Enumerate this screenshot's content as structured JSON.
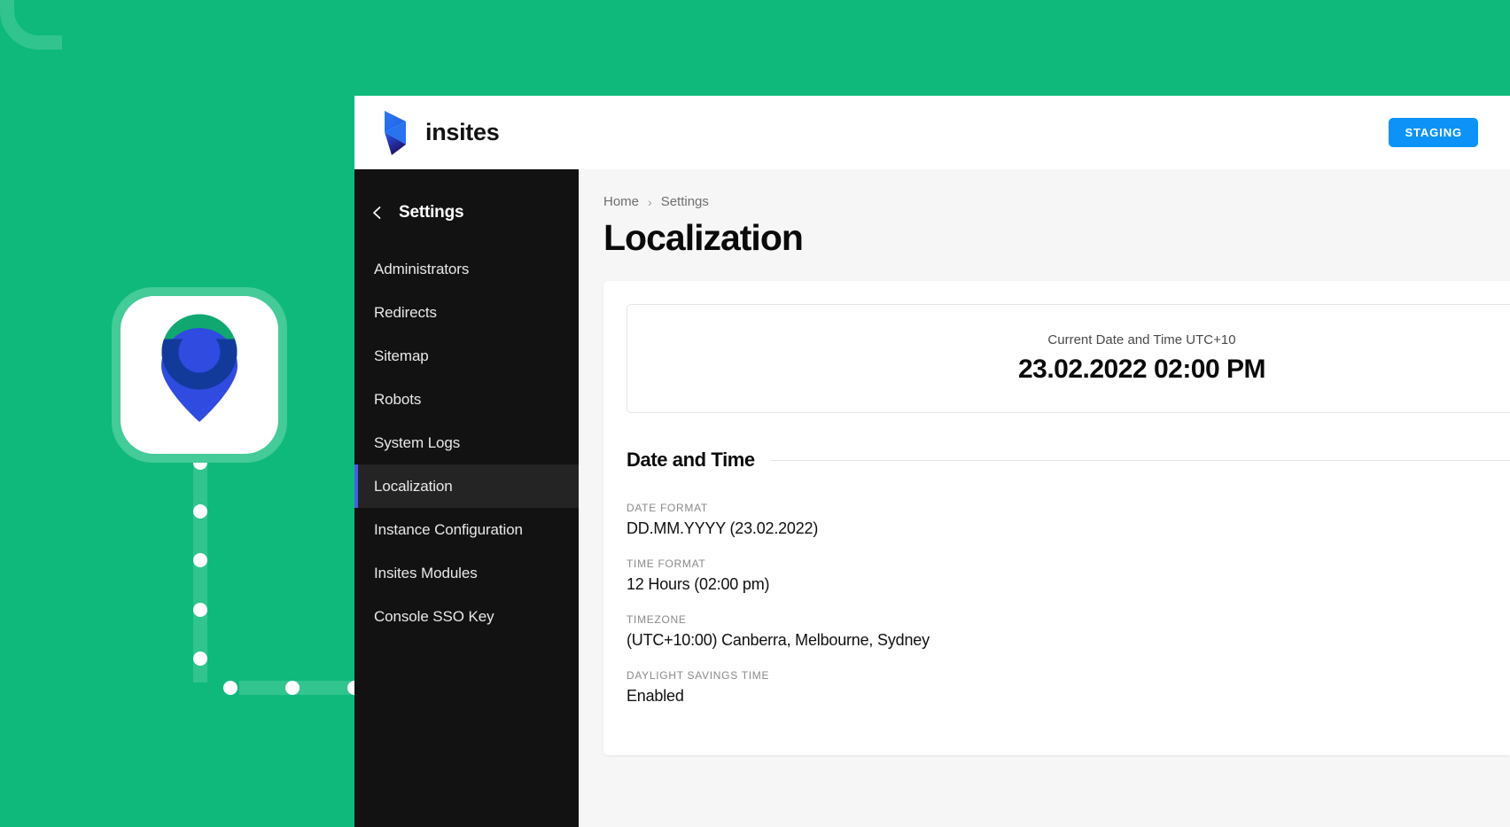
{
  "theme": {
    "backdrop_green": "#0FB97C",
    "track_green": "#32C48E",
    "sidebar_dark": "#121212",
    "accent_blue": "#4560E6",
    "badge_blue": "#0D93F7",
    "pin_blue": "#2F4BE0",
    "pin_green": "#10A870"
  },
  "topbar": {
    "brand_name": "insites",
    "logo_icon": "insites-arrow-logo",
    "environment_badge": "STAGING"
  },
  "sidebar": {
    "back_icon": "chevron-left-icon",
    "title": "Settings",
    "items": [
      {
        "label": "Administrators",
        "active": false
      },
      {
        "label": "Redirects",
        "active": false
      },
      {
        "label": "Sitemap",
        "active": false
      },
      {
        "label": "Robots",
        "active": false
      },
      {
        "label": "System Logs",
        "active": false
      },
      {
        "label": "Localization",
        "active": true
      },
      {
        "label": "Instance Configuration",
        "active": false
      },
      {
        "label": "Insites Modules",
        "active": false
      },
      {
        "label": "Console SSO Key",
        "active": false
      }
    ]
  },
  "main": {
    "breadcrumb": {
      "home": "Home",
      "separator": "›",
      "current": "Settings"
    },
    "page_title": "Localization",
    "current_time_box": {
      "label": "Current Date and Time UTC+10",
      "value": "23.02.2022 02:00 PM"
    },
    "section": {
      "heading": "Date and Time",
      "fields": [
        {
          "label": "DATE FORMAT",
          "value": "DD.MM.YYYY (23.02.2022)"
        },
        {
          "label": "TIME FORMAT",
          "value": "12 Hours (02:00 pm)"
        },
        {
          "label": "TIMEZONE",
          "value": "(UTC+10:00) Canberra, Melbourne, Sydney"
        },
        {
          "label": "DAYLIGHT SAVINGS TIME",
          "value": "Enabled"
        }
      ]
    }
  },
  "backdrop": {
    "pin_icon": "location-pin-icon",
    "track_dots": 8
  }
}
